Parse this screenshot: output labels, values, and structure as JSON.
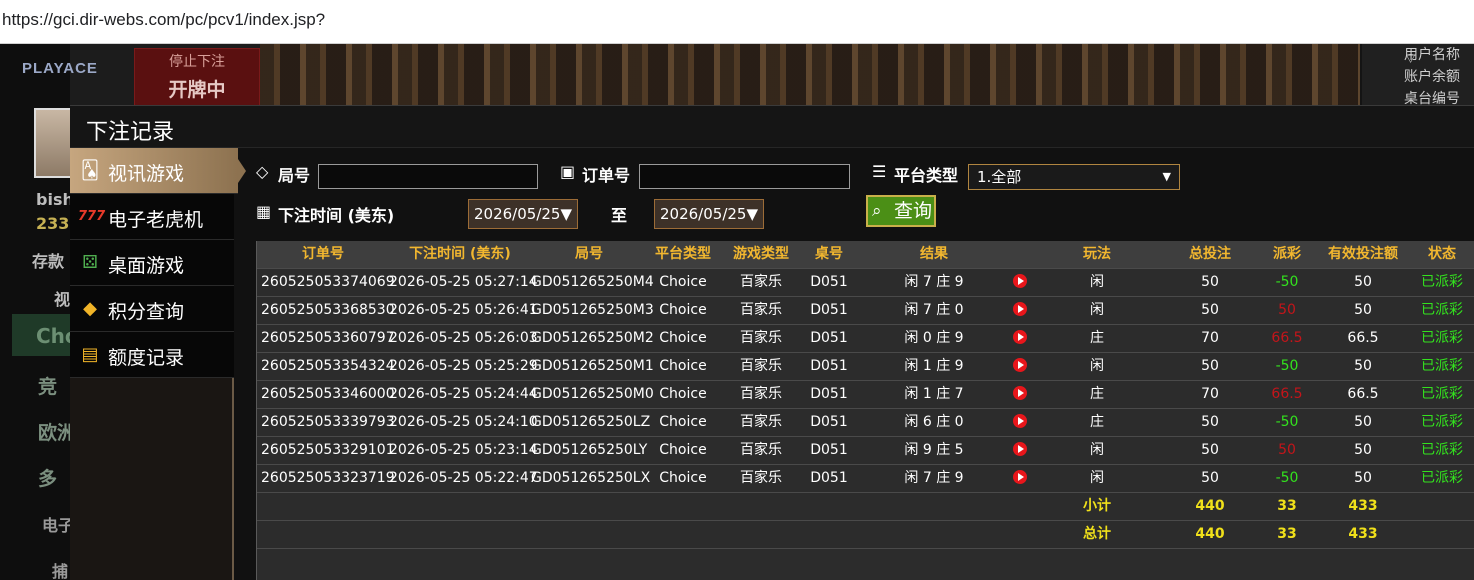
{
  "browser": {
    "url": "https://gci.dir-webs.com/pc/pcv1/index.jsp?"
  },
  "lobby": {
    "logo": "PLAYACE",
    "status_top": "停止下注",
    "status_bottom": "开牌中",
    "right_labels": [
      "用户名称",
      "账户余额",
      "桌台编号"
    ],
    "side_labels": [
      "bish",
      "233.",
      "存款",
      "视",
      "Cho",
      "竞",
      "欧洲",
      "多",
      "电子",
      "捕"
    ]
  },
  "modal": {
    "title": "下注记录",
    "sidebar": [
      {
        "label": "视讯游戏",
        "icon": "playing-cards-icon",
        "active": true
      },
      {
        "label": "电子老虎机",
        "icon": "slot-777-icon",
        "active": false
      },
      {
        "label": "桌面游戏",
        "icon": "dice-icon",
        "active": false
      },
      {
        "label": "积分查询",
        "icon": "diamond-icon",
        "active": false
      },
      {
        "label": "额度记录",
        "icon": "document-icon",
        "active": false
      }
    ],
    "filters": {
      "round_label": "局号",
      "round_value": "",
      "order_label": "订单号",
      "order_value": "",
      "platform_label": "平台类型",
      "platform_value": "1.全部",
      "time_label": "下注时间 (美东)",
      "date_from": "2026/05/25▼",
      "to_label": "至",
      "date_to": "2026/05/25▼",
      "query_label": "查询"
    },
    "table": {
      "headers": [
        "订单号",
        "下注时间 (美东)",
        "局号",
        "平台类型",
        "游戏类型",
        "桌号",
        "结果",
        "玩法",
        "总投注",
        "派彩",
        "有效投注额",
        "状态"
      ],
      "rows": [
        {
          "order": "260525053374069",
          "time": "2026-05-25 05:27:14",
          "round": "GD051265250M4",
          "platform": "Choice",
          "game": "百家乐",
          "table": "D051",
          "result": "闲 7 庄 9",
          "play": "闲",
          "bet": "50",
          "payout": "-50",
          "payout_color": "green",
          "valid": "50",
          "status": "已派彩"
        },
        {
          "order": "260525053368530",
          "time": "2026-05-25 05:26:41",
          "round": "GD051265250M3",
          "platform": "Choice",
          "game": "百家乐",
          "table": "D051",
          "result": "闲 7 庄 0",
          "play": "闲",
          "bet": "50",
          "payout": "50",
          "payout_color": "red",
          "valid": "50",
          "status": "已派彩"
        },
        {
          "order": "260525053360797",
          "time": "2026-05-25 05:26:03",
          "round": "GD051265250M2",
          "platform": "Choice",
          "game": "百家乐",
          "table": "D051",
          "result": "闲 0 庄 9",
          "play": "庄",
          "bet": "70",
          "payout": "66.5",
          "payout_color": "red",
          "valid": "66.5",
          "status": "已派彩"
        },
        {
          "order": "260525053354324",
          "time": "2026-05-25 05:25:29",
          "round": "GD051265250M1",
          "platform": "Choice",
          "game": "百家乐",
          "table": "D051",
          "result": "闲 1 庄 9",
          "play": "闲",
          "bet": "50",
          "payout": "-50",
          "payout_color": "green",
          "valid": "50",
          "status": "已派彩"
        },
        {
          "order": "260525053346000",
          "time": "2026-05-25 05:24:44",
          "round": "GD051265250M0",
          "platform": "Choice",
          "game": "百家乐",
          "table": "D051",
          "result": "闲 1 庄 7",
          "play": "庄",
          "bet": "70",
          "payout": "66.5",
          "payout_color": "red",
          "valid": "66.5",
          "status": "已派彩"
        },
        {
          "order": "260525053339793",
          "time": "2026-05-25 05:24:10",
          "round": "GD051265250LZ",
          "platform": "Choice",
          "game": "百家乐",
          "table": "D051",
          "result": "闲 6 庄 0",
          "play": "庄",
          "bet": "50",
          "payout": "-50",
          "payout_color": "green",
          "valid": "50",
          "status": "已派彩"
        },
        {
          "order": "260525053329101",
          "time": "2026-05-25 05:23:14",
          "round": "GD051265250LY",
          "platform": "Choice",
          "game": "百家乐",
          "table": "D051",
          "result": "闲 9 庄 5",
          "play": "闲",
          "bet": "50",
          "payout": "50",
          "payout_color": "red",
          "valid": "50",
          "status": "已派彩"
        },
        {
          "order": "260525053323719",
          "time": "2026-05-25 05:22:47",
          "round": "GD051265250LX",
          "platform": "Choice",
          "game": "百家乐",
          "table": "D051",
          "result": "闲 7 庄 9",
          "play": "闲",
          "bet": "50",
          "payout": "-50",
          "payout_color": "green",
          "valid": "50",
          "status": "已派彩"
        }
      ],
      "subtotal": {
        "label": "小计",
        "bet": "440",
        "payout": "33",
        "valid": "433"
      },
      "total": {
        "label": "总计",
        "bet": "440",
        "payout": "33",
        "valid": "433"
      }
    }
  },
  "colors": {
    "accent_gold": "#f2b72f",
    "win_green": "#33e21e",
    "loss_red": "#c4151a",
    "total_yellow": "#f0e01a",
    "query_green": "#4b8f16"
  }
}
